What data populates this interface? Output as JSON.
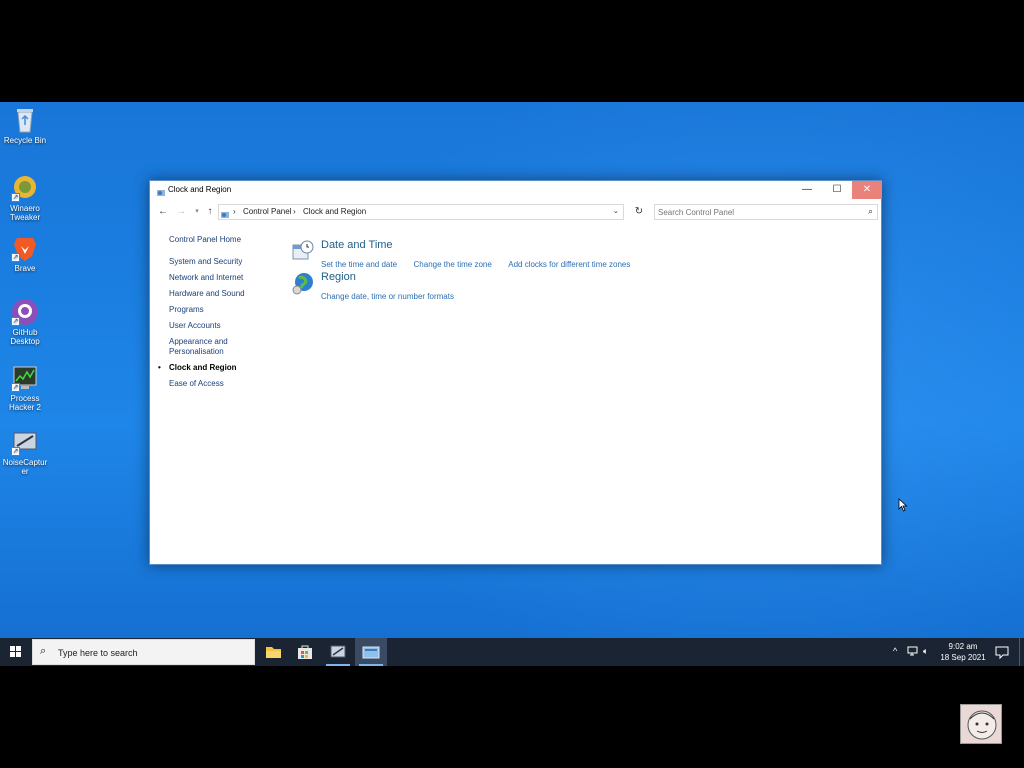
{
  "desktop_icons": [
    {
      "label": "Recycle Bin"
    },
    {
      "label": "Winaero Tweaker"
    },
    {
      "label": "Brave"
    },
    {
      "label": "GitHub Desktop"
    },
    {
      "label": "Process Hacker 2"
    },
    {
      "label": "NoiseCapturer"
    }
  ],
  "window": {
    "title": "Clock and Region",
    "controls": {
      "minimize": "—",
      "maximize": "☐",
      "close": "✕"
    },
    "breadcrumb": [
      "Control Panel",
      "Clock and Region"
    ],
    "search_placeholder": "Search Control Panel",
    "left_nav": {
      "home": "Control Panel Home",
      "items": [
        "System and Security",
        "Network and Internet",
        "Hardware and Sound",
        "Programs",
        "User Accounts",
        "Appearance and Personalisation",
        "Clock and Region",
        "Ease of Access"
      ],
      "current": "Clock and Region"
    },
    "categories": [
      {
        "title": "Date and Time",
        "links": [
          "Set the time and date",
          "Change the time zone",
          "Add clocks for different time zones"
        ]
      },
      {
        "title": "Region",
        "links": [
          "Change date, time or number formats"
        ]
      }
    ]
  },
  "taskbar": {
    "search_placeholder": "Type here to search",
    "clock_time": "9:02 am",
    "clock_date": "18 Sep 2021"
  },
  "colors": {
    "desktop_blue": "#1a7ddf",
    "taskbar": "#1b2433",
    "close_button": "#e8827a",
    "link": "#2a6fb5"
  }
}
